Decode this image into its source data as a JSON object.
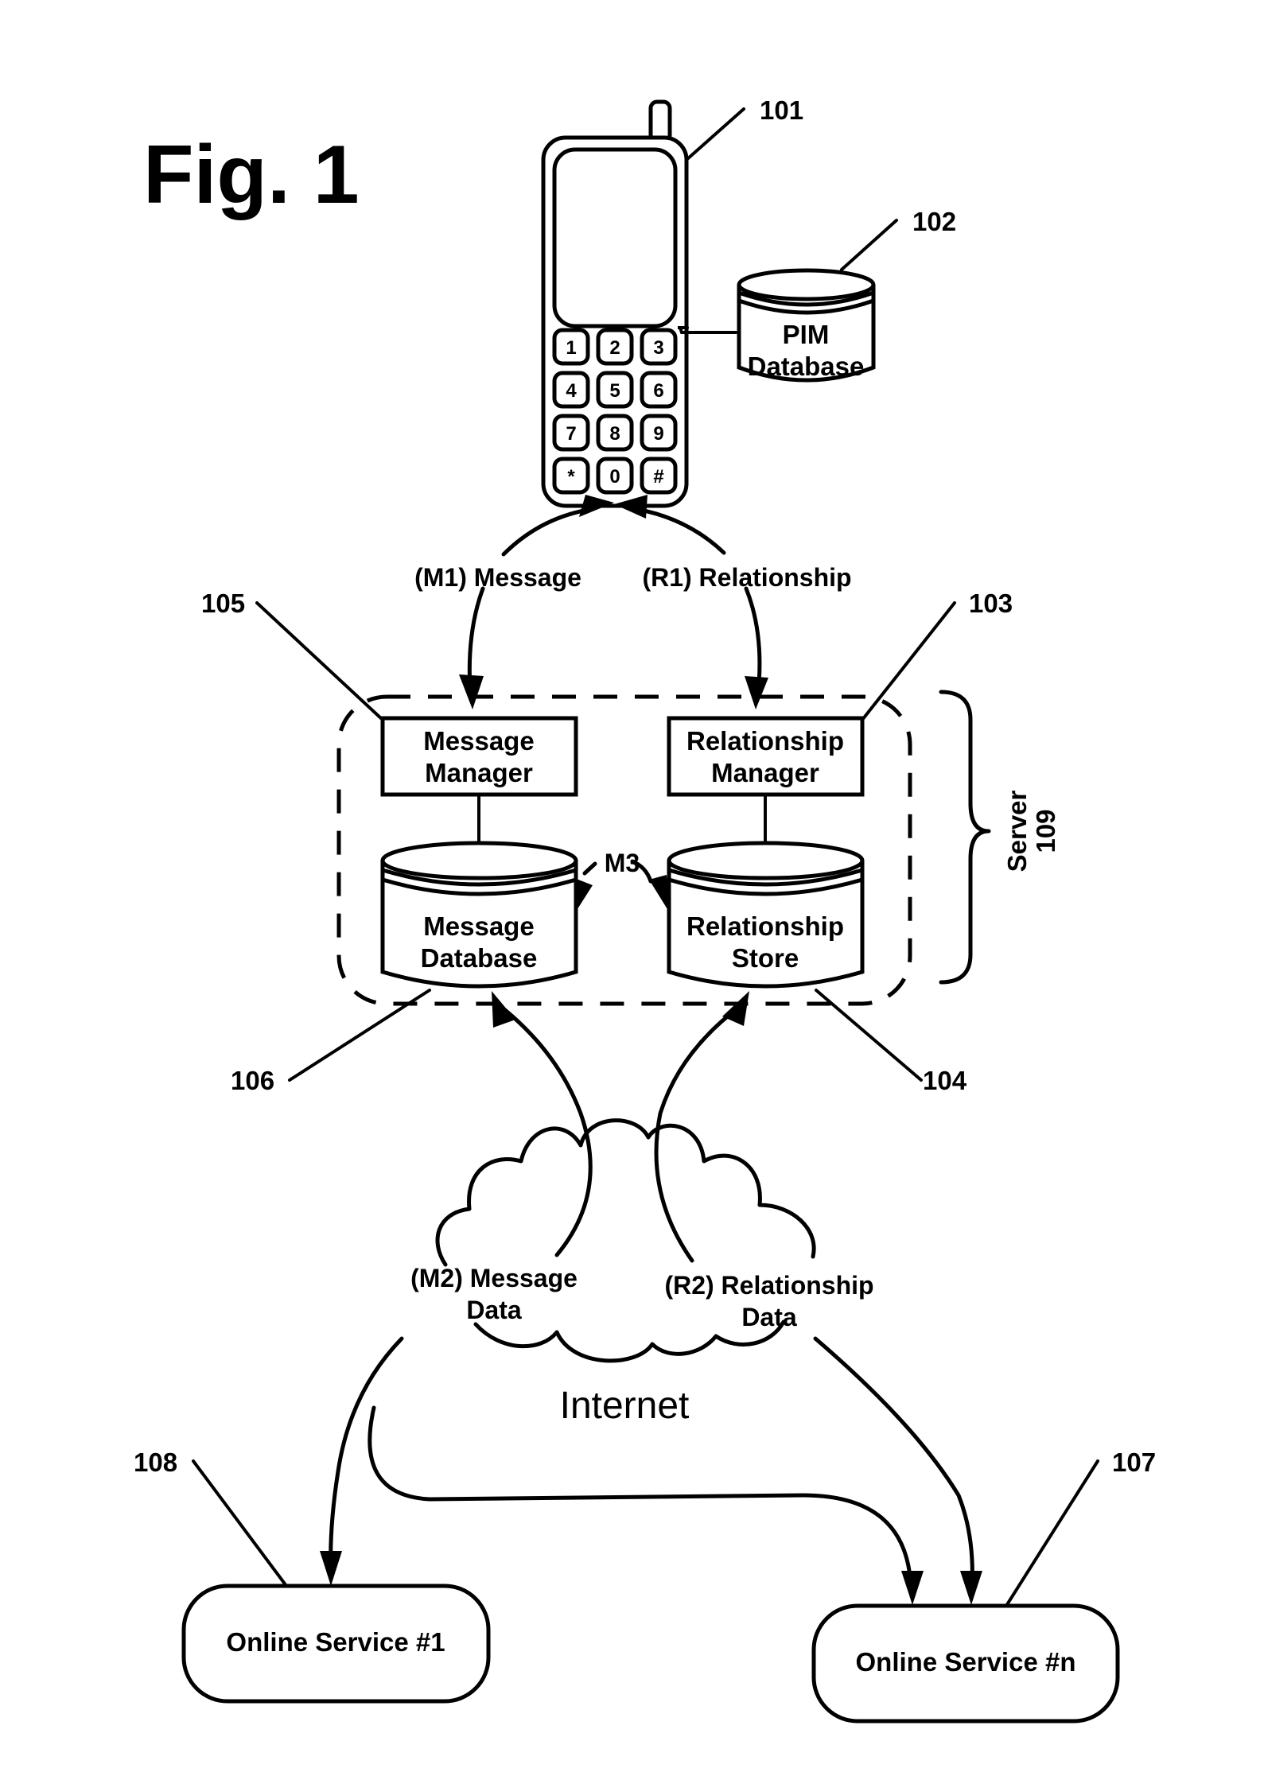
{
  "figure": {
    "title": "Fig. 1"
  },
  "phone": {
    "ref": "101",
    "keys": [
      "1",
      "2",
      "3",
      "4",
      "5",
      "6",
      "7",
      "8",
      "9",
      "*",
      "0",
      "#"
    ]
  },
  "pim_database": {
    "ref": "102",
    "line1": "PIM",
    "line2": "Database"
  },
  "flows": {
    "m1": "(M1) Message",
    "r1": "(R1) Relationship",
    "m3": "M3",
    "m2_line1": "(M2) Message",
    "m2_line2": "Data",
    "r2_line1": "(R2) Relationship",
    "r2_line2": "Data"
  },
  "server": {
    "label": "Server",
    "ref": "109",
    "message_manager": {
      "ref": "105",
      "line1": "Message",
      "line2": "Manager"
    },
    "relationship_manager": {
      "ref": "103",
      "line1": "Relationship",
      "line2": "Manager"
    },
    "message_database": {
      "ref": "106",
      "line1": "Message",
      "line2": "Database"
    },
    "relationship_store": {
      "ref": "104",
      "line1": "Relationship",
      "line2": "Store"
    }
  },
  "internet": {
    "label": "Internet"
  },
  "services": [
    {
      "ref": "108",
      "label": "Online Service #1"
    },
    {
      "ref": "107",
      "label": "Online Service #n"
    }
  ]
}
